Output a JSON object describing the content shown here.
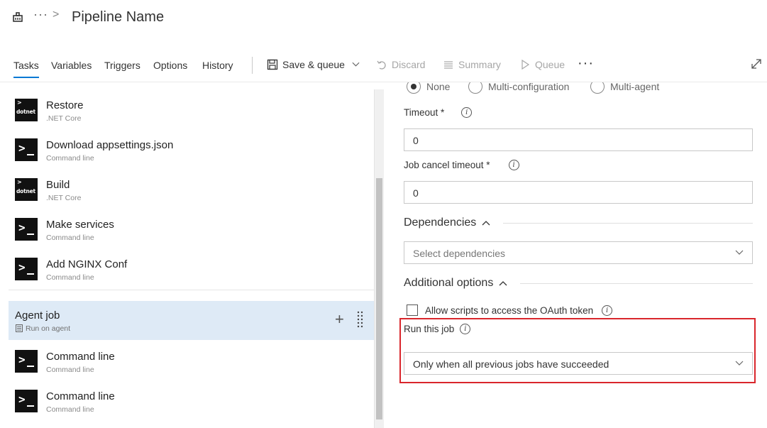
{
  "header": {
    "title": "Pipeline Name",
    "breadcrumb_more": "···",
    "breadcrumb_sep": ">"
  },
  "toolbar": {
    "tabs": [
      "Tasks",
      "Variables",
      "Triggers",
      "Options",
      "History"
    ],
    "active_tab": "Tasks",
    "save_queue": "Save & queue",
    "discard": "Discard",
    "summary": "Summary",
    "queue": "Queue",
    "more": "···"
  },
  "tasks": [
    {
      "name": "Restore",
      "type": ".NET Core",
      "icon": "dotnet-icon"
    },
    {
      "name": "Download appsettings.json",
      "type": "Command line",
      "icon": "command-line-icon"
    },
    {
      "name": "Build",
      "type": ".NET Core",
      "icon": "dotnet-icon"
    },
    {
      "name": "Make services",
      "type": "Command line",
      "icon": "command-line-icon"
    },
    {
      "name": "Add NGINX Conf",
      "type": "Command line",
      "icon": "command-line-icon"
    }
  ],
  "dotnet_icon_label": "dotnet",
  "agent_job": {
    "title": "Agent job",
    "subtitle": "Run on agent",
    "tasks": [
      {
        "name": "Command line",
        "type": "Command line"
      },
      {
        "name": "Command line",
        "type": "Command line"
      }
    ]
  },
  "right": {
    "parallelism": {
      "options": [
        "None",
        "Multi-configuration",
        "Multi-agent"
      ],
      "selected": "None"
    },
    "timeout": {
      "label": "Timeout *",
      "value": "0"
    },
    "cancel_timeout": {
      "label": "Job cancel timeout *",
      "value": "0"
    },
    "dependencies": {
      "title": "Dependencies",
      "placeholder": "Select dependencies"
    },
    "additional_options": {
      "title": "Additional options"
    },
    "oauth": {
      "label": "Allow scripts to access the OAuth token",
      "checked": false
    },
    "run_this_job": {
      "label": "Run this job",
      "value": "Only when all previous jobs have succeeded"
    }
  },
  "colors": {
    "accent": "#0078d4",
    "agent_job_bg": "#deeaf6",
    "highlight": "#d9262c"
  }
}
